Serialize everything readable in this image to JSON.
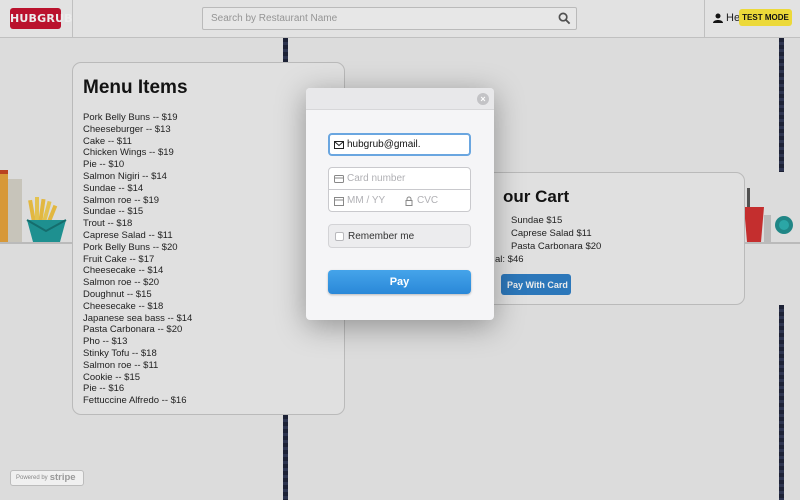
{
  "header": {
    "logo_text": "HUBGRUB",
    "search_placeholder": "Search by Restaurant Name",
    "user_greeting": "He",
    "test_mode_badge": "TEST MODE"
  },
  "menu": {
    "title": "Menu Items",
    "items": [
      "Pork Belly Buns -- $19",
      "Cheeseburger -- $13",
      "Cake -- $11",
      "Chicken Wings -- $19",
      "Pie -- $10",
      "Salmon Nigiri -- $14",
      "Sundae -- $14",
      "Salmon roe -- $19",
      "Sundae -- $15",
      "Trout -- $18",
      "Caprese Salad -- $11",
      "Pork Belly Buns -- $20",
      "Fruit Cake -- $17",
      "Cheesecake -- $14",
      "Salmon roe -- $20",
      "Doughnut -- $15",
      "Cheesecake -- $18",
      "Japanese sea bass -- $14",
      "Pasta Carbonara -- $20",
      "Pho -- $13",
      "Stinky Tofu -- $18",
      "Salmon roe -- $11",
      "Cookie -- $15",
      "Pie -- $16",
      "Fettuccine Alfredo -- $16"
    ]
  },
  "cart": {
    "title": "our Cart",
    "items": [
      "Sundae $15",
      "Caprese Salad $11",
      "Pasta Carbonara $20"
    ],
    "total": "al: $46",
    "button_label": "Pay With Card"
  },
  "checkout": {
    "close_symbol": "×",
    "email_value": "hubgrub@gmail.",
    "card_number_placeholder": "Card number",
    "expiry_placeholder": "MM / YY",
    "cvc_placeholder": "CVC",
    "remember_label": "Remember me",
    "pay_label": "Pay"
  },
  "footer": {
    "powered_by": "Powered by",
    "stripe": "stripe"
  },
  "colors": {
    "brand_red": "#c8102e",
    "pay_blue": "#2a88d8",
    "test_mode_yellow": "#ffeb3b"
  }
}
